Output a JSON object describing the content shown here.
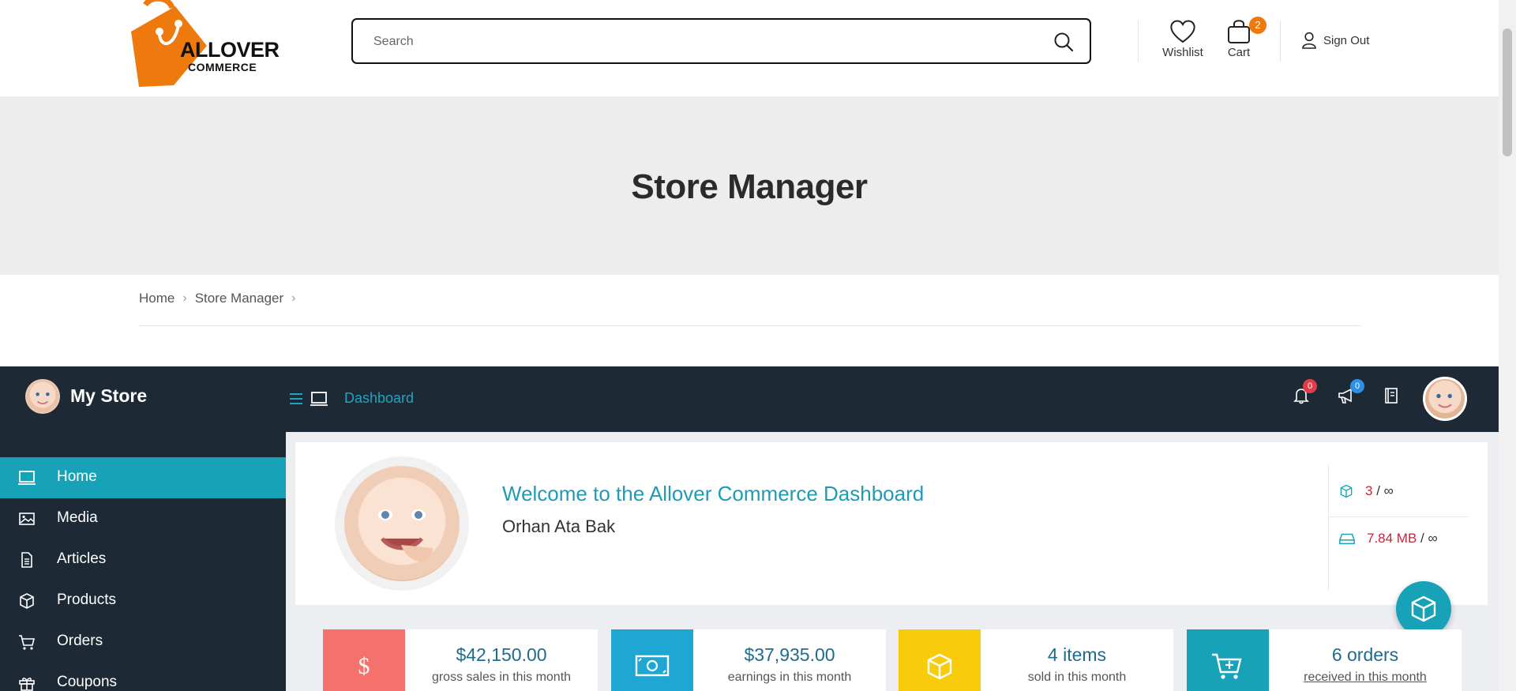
{
  "header": {
    "logo_title": "ALLOVER",
    "logo_subtitle": "COMMERCE",
    "search_placeholder": "Search",
    "wishlist_label": "Wishlist",
    "cart_label": "Cart",
    "cart_count": "2",
    "signout_label": "Sign Out",
    "brand_color": "#ee7a0e"
  },
  "hero": {
    "title": "Store Manager"
  },
  "breadcrumb": {
    "items": [
      "Home",
      "Store Manager"
    ]
  },
  "dashboard": {
    "store_name": "My Store",
    "menu_label": "Dashboard",
    "notifications_count": "0",
    "announcements_count": "0",
    "accent_color": "#17a2b8",
    "sidebar": {
      "items": [
        {
          "label": "Home",
          "icon": "monitor-icon",
          "active": true
        },
        {
          "label": "Media",
          "icon": "image-icon",
          "active": false
        },
        {
          "label": "Articles",
          "icon": "document-icon",
          "active": false
        },
        {
          "label": "Products",
          "icon": "cube-icon",
          "active": false
        },
        {
          "label": "Orders",
          "icon": "cart-icon",
          "active": false
        },
        {
          "label": "Coupons",
          "icon": "gift-icon",
          "active": false
        }
      ]
    },
    "welcome": {
      "title": "Welcome to the Allover Commerce Dashboard",
      "user_name": "Orhan Ata Bak"
    },
    "quota": {
      "products_used": "3",
      "products_limit": "∞",
      "space_used": "7.84 MB",
      "space_limit": "∞",
      "separator": "/"
    },
    "stats": [
      {
        "value": "$42,150.00",
        "label": "gross sales in this month",
        "color": "#f4716c",
        "icon": "dollar-icon"
      },
      {
        "value": "$37,935.00",
        "label": "earnings in this month",
        "color": "#1fa7d4",
        "icon": "money-icon"
      },
      {
        "value": "4 items",
        "label": "sold in this month",
        "color": "#f9cc0b",
        "icon": "cube-icon"
      },
      {
        "value": "6 orders",
        "label": "received in this month",
        "color": "#17a2b8",
        "icon": "cart-plus-icon"
      }
    ]
  }
}
